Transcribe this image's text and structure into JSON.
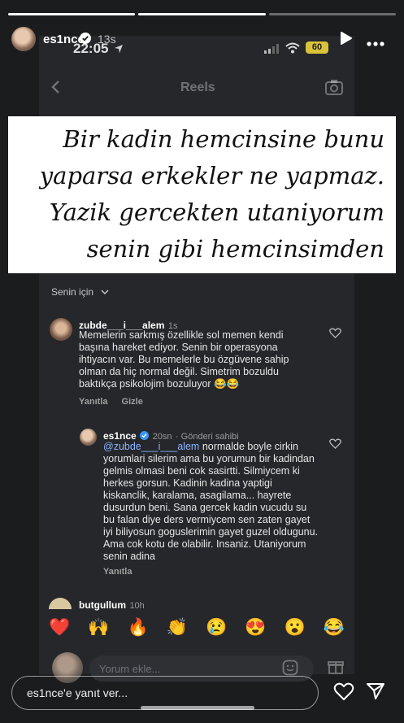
{
  "story": {
    "progress": [
      1,
      1,
      0.0
    ],
    "username": "es1nce",
    "age": "13s",
    "reply_placeholder": "es1nce'e yanıt ver..."
  },
  "status_bar": {
    "time": "22:05",
    "battery": "60"
  },
  "screen_title": "Reels",
  "caption_lines": [
    "Bir kadin hemcinsine bunu",
    "yaparsa erkekler ne yapmaz.",
    "Yazik gercekten utaniyorum",
    "senin gibi hemcinsimden"
  ],
  "comments_filter": "Senin için",
  "comments": [
    {
      "username": "zubde___i___alem",
      "time": "1s",
      "text": "Memelerin sarkmış özellikle sol memen kendi başına hareket ediyor. Senin bir operasyona ihtiyacın var. Bu memelerle bu özgüvene sahip olman da hiç normal değil. Simetrim bozuldu baktıkça psikolojim bozuluyor 😂😂",
      "actions": [
        "Yanıtla",
        "Gizle"
      ]
    },
    {
      "username": "es1nce",
      "time": "20sn",
      "badge": "Gönderi sahibi",
      "mention": "@zubde___i___alem",
      "text": " normalde boyle cirkin yorumlari silerim ama bu yorumun bir kadindan gelmis olmasi beni cok sasirtti. Silmiycem ki herkes gorsun. Kadinin kadina yaptigi kiskanclik, karalama, asagilama... hayrete dusurdun beni. Sana gercek kadin vucudu su bu falan diye ders vermiycem sen zaten gayet iyi biliyosun goguslerimin gayet guzel oldugunu. Ama cok kotu de olabilir. Insaniz. Utaniyorum senin adina",
      "actions": [
        "Yanıtla"
      ]
    },
    {
      "username": "butgullum",
      "time": "10h"
    }
  ],
  "emojis": [
    "❤️",
    "🙌",
    "🔥",
    "👏",
    "😢",
    "😍",
    "😮",
    "😂"
  ],
  "comment_input_placeholder": "Yorum ekle...",
  "colors": {
    "mention": "#8bb4ff",
    "battery": "#d8c23a",
    "verified": "#3897f0"
  }
}
